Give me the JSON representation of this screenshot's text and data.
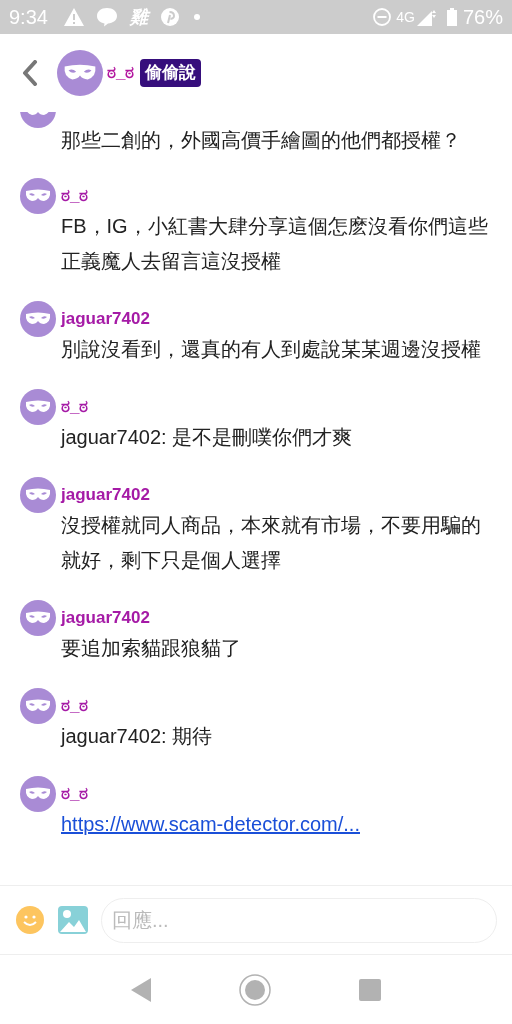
{
  "status_bar": {
    "time": "9:34",
    "notification_glyph": "雞",
    "network": "4G",
    "battery": "76%"
  },
  "header": {
    "name": "ಠ_ಠ",
    "badge": "偷偷說"
  },
  "messages": [
    {
      "kind": "text",
      "partial": true,
      "text": "那些二創的，外國高價手繪圖的他們都授權？"
    },
    {
      "kind": "text",
      "author": "ಠ_ಠ",
      "text": "FB，IG，小紅書大肆分享這個怎麽沒看你們這些正義魔人去留言這沒授權"
    },
    {
      "kind": "text",
      "author": "jaguar7402",
      "text": "別說沒看到，還真的有人到處說某某週邊沒授權"
    },
    {
      "kind": "text",
      "author": "ಠ_ಠ",
      "text": "jaguar7402: 是不是刪噗你們才爽"
    },
    {
      "kind": "text",
      "author": "jaguar7402",
      "text": "沒授權就同人商品，本來就有市場，不要用騙的就好，剩下只是個人選擇"
    },
    {
      "kind": "text",
      "author": "jaguar7402",
      "text": "要追加索貓跟狼貓了"
    },
    {
      "kind": "text",
      "author": "ಠ_ಠ",
      "text": "jaguar7402: 期待"
    },
    {
      "kind": "link",
      "author": "ಠ_ಠ",
      "text": "https://www.scam-detector.com/..."
    }
  ],
  "reply_box": {
    "placeholder": "回應..."
  }
}
